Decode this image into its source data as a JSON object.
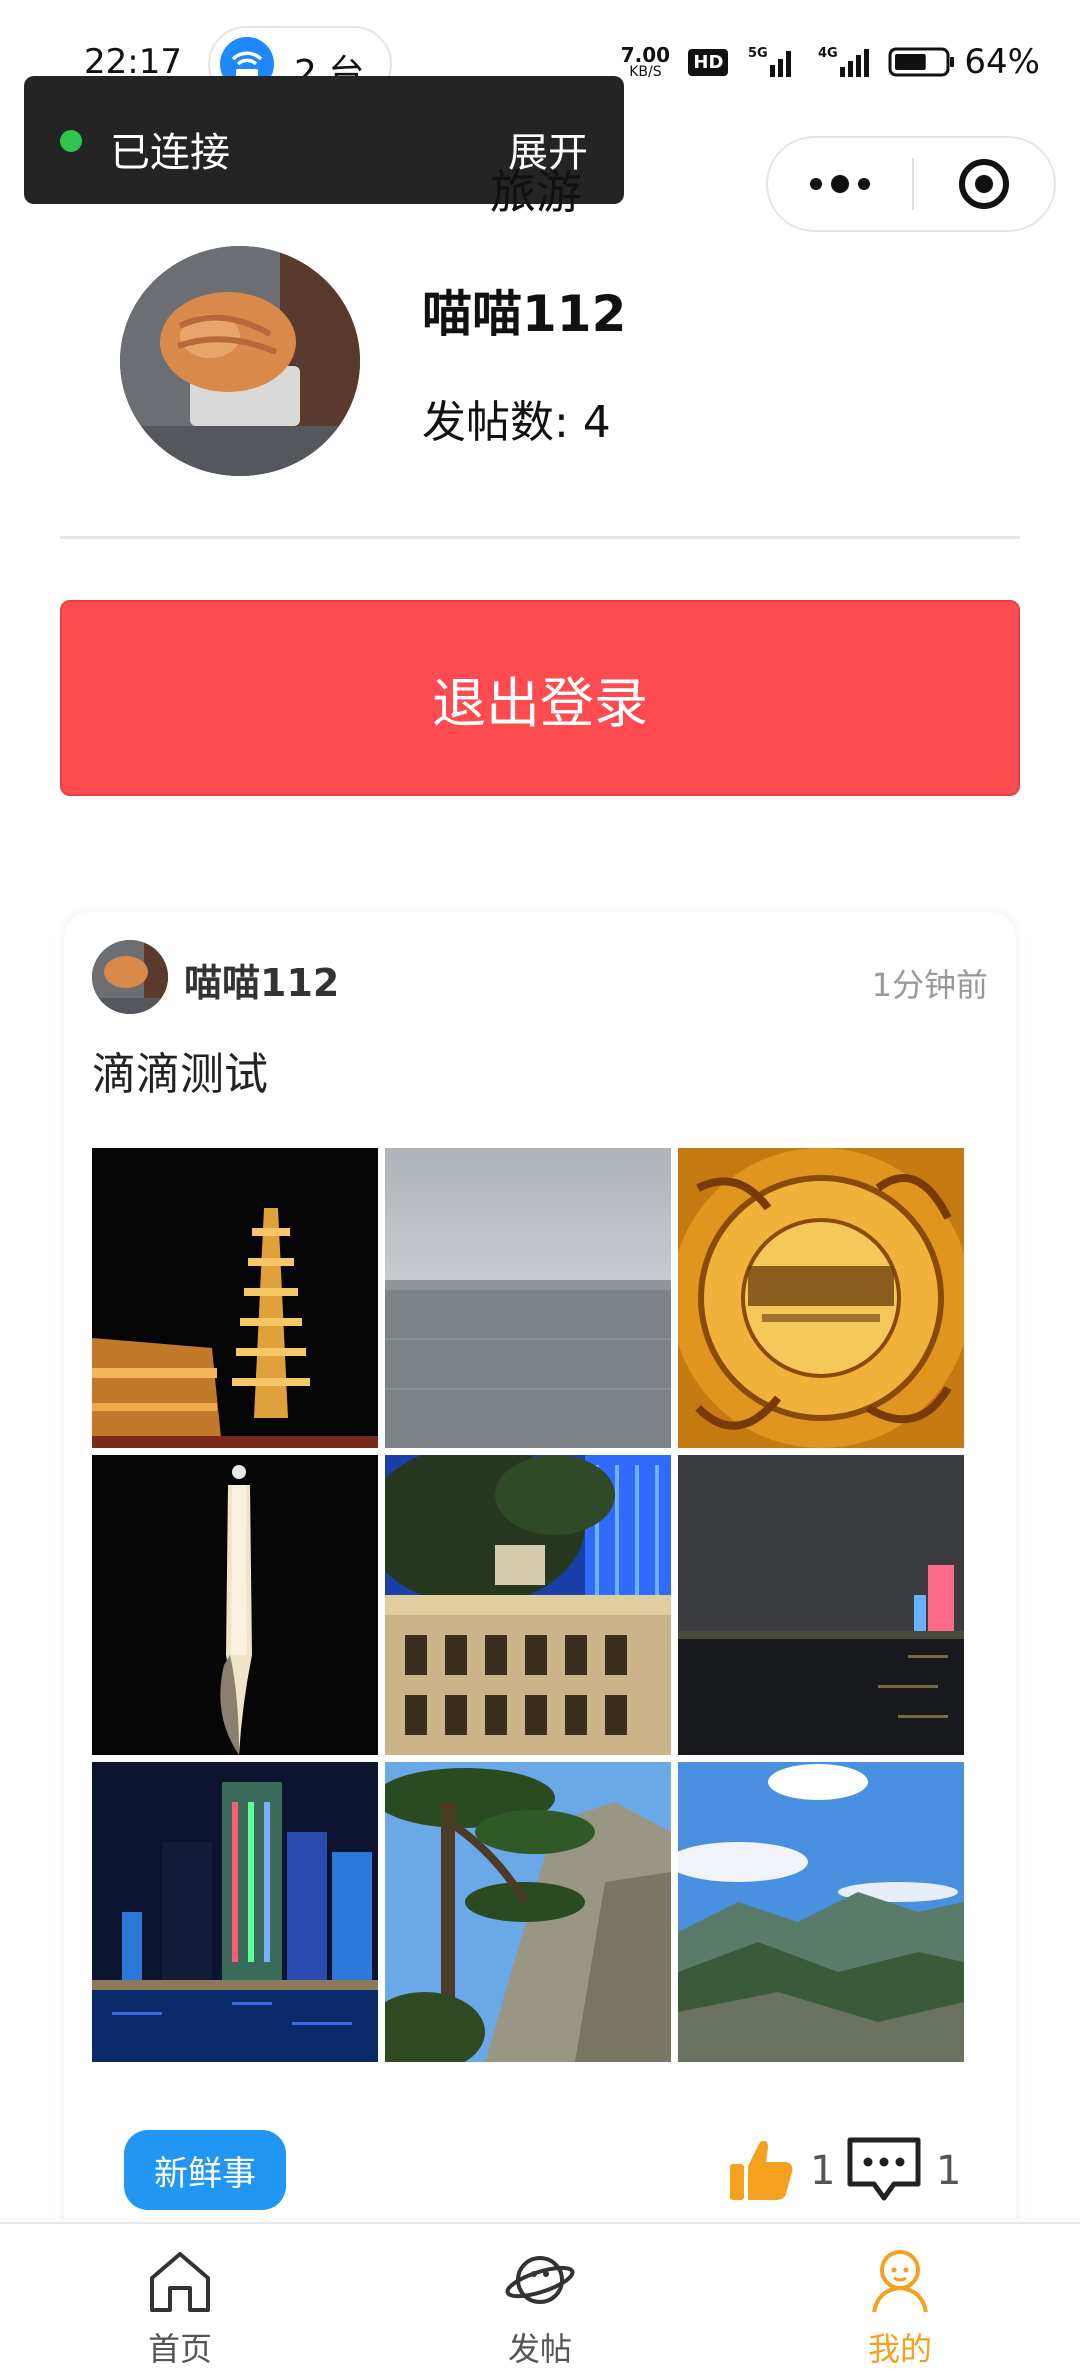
{
  "status_bar": {
    "time": "22:17",
    "hotspot_count": "2 台",
    "net_speed_value": "7.00",
    "net_speed_unit": "KB/S",
    "hd_label": "HD",
    "signal_1": "5G",
    "signal_2": "4G",
    "battery_level": 0.64,
    "battery_text": "64%"
  },
  "toast": {
    "text": "已连接",
    "action": "展开",
    "dot_color": "#2ec64d"
  },
  "nav": {
    "title": "旅游"
  },
  "profile": {
    "name": "喵喵112",
    "post_count_label": "发帖数: 4"
  },
  "logout": {
    "label": "退出登录",
    "color": "#fe4b4f"
  },
  "post": {
    "author": "喵喵112",
    "time": "1分钟前",
    "text": "滴滴测试",
    "images": [
      {
        "name": "pagoda-night-photo"
      },
      {
        "name": "grey-lake-photo"
      },
      {
        "name": "golden-plaque-photo"
      },
      {
        "name": "light-sculpture-night-photo"
      },
      {
        "name": "historic-building-photo"
      },
      {
        "name": "river-night-skyline-photo"
      },
      {
        "name": "illuminated-towers-photo"
      },
      {
        "name": "pine-mountain-photo"
      },
      {
        "name": "mountain-vista-photo"
      }
    ],
    "tag": "新鲜事",
    "like_count": "1",
    "comment_count": "1",
    "accent_color": "#2196f3"
  },
  "tabs": [
    {
      "label": "首页",
      "icon": "home-icon"
    },
    {
      "label": "发帖",
      "icon": "planet-icon"
    },
    {
      "label": "我的",
      "icon": "profile-icon",
      "active": true
    }
  ],
  "active_color": "#f5a01e"
}
